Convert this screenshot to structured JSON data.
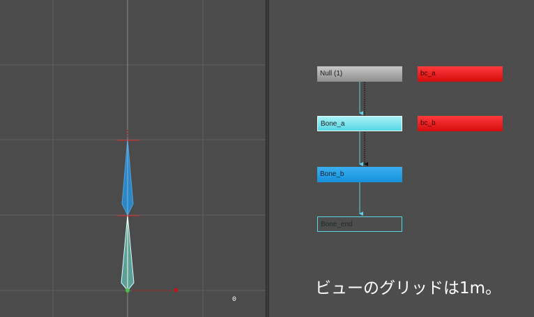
{
  "viewport": {
    "frame_number": "0"
  },
  "schematic": {
    "nodes": {
      "null": "Null (1)",
      "bone_a": "Bone_a",
      "bone_b": "Bone_b",
      "bone_end": "Bone_end",
      "bc_a": "bc_a",
      "bc_b": "bc_b"
    },
    "colors": {
      "bone": "#55d6e4",
      "bone_selected": "#1690dc",
      "constraint": "#d40c0c",
      "null": "#a0a0a0",
      "link_arrow": "#5fd0ea"
    }
  },
  "caption": "ビューのグリッドは1m。"
}
